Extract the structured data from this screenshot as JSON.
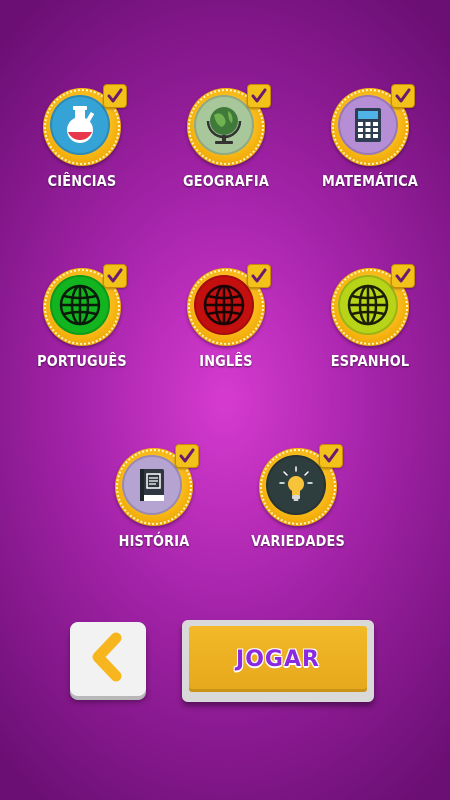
{
  "categories": [
    {
      "label": "CIÊNCIAS",
      "icon": "flask-icon",
      "bg": "#35a3d6"
    },
    {
      "label": "GEOGRAFIA",
      "icon": "globe-icon",
      "bg": "#a8c79b"
    },
    {
      "label": "MATEMÁTICA",
      "icon": "calculator-icon",
      "bg": "#b58ed6"
    },
    {
      "label": "PORTUGUÊS",
      "icon": "green-globe-icon",
      "bg": "#12b51f"
    },
    {
      "label": "INGLÊS",
      "icon": "red-globe-icon",
      "bg": "#c40f0f"
    },
    {
      "label": "ESPANHOL",
      "icon": "yellow-green-globe-icon",
      "bg": "#b8d418"
    },
    {
      "label": "HISTÓRIA",
      "icon": "book-icon",
      "bg": "#b5a3d2"
    },
    {
      "label": "VARIEDADES",
      "icon": "lightbulb-icon",
      "bg": "#2e3d3d"
    }
  ],
  "actions": {
    "back_icon": "chevron-left-icon",
    "play_label": "JOGAR"
  },
  "colors": {
    "ring": "#f6b30f",
    "check": "#f2c11a",
    "back_chevron": "#f7b51e",
    "play_label": "#8a2be2"
  }
}
